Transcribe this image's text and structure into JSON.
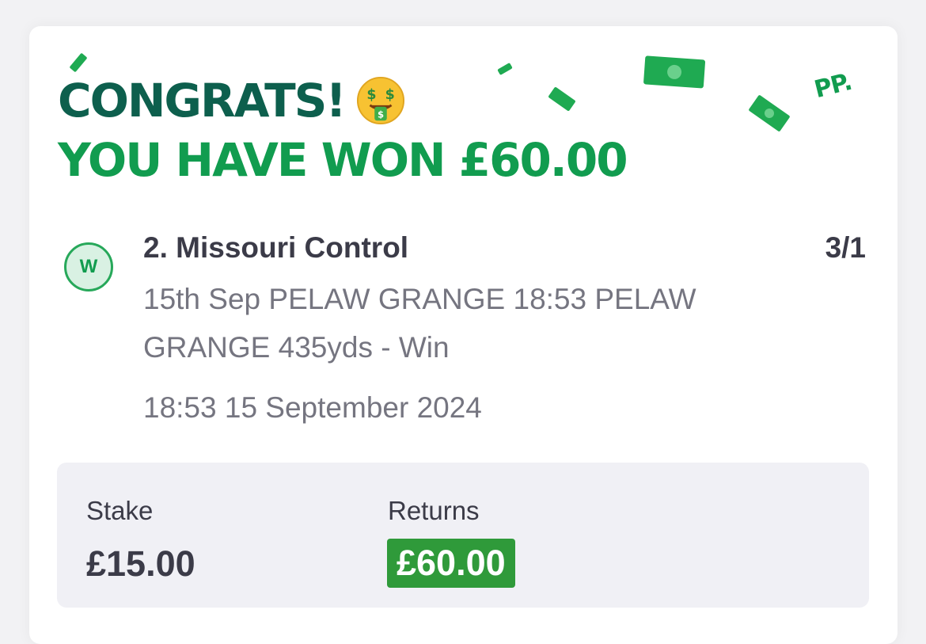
{
  "colors": {
    "dark_green": "#0d5f4d",
    "bright_green": "#119c4f",
    "returns_bg": "#2f9a3a",
    "badge_bg": "#d9f1e3",
    "badge_border": "#27a85a"
  },
  "header": {
    "congrats": "CONGRATS!",
    "emoji_icon": "money-mouth-face-icon",
    "won_message": "YOU HAVE WON £60.00",
    "logo": "PP."
  },
  "bet": {
    "result_badge": "W",
    "selection": "2. Missouri Control",
    "odds": "3/1",
    "market": "15th Sep PELAW GRANGE 18:53 PELAW GRANGE 435yds - Win",
    "event_time": "18:53 15 September 2024"
  },
  "summary": {
    "stake_label": "Stake",
    "stake_value": "£15.00",
    "returns_label": "Returns",
    "returns_value": "£60.00"
  }
}
